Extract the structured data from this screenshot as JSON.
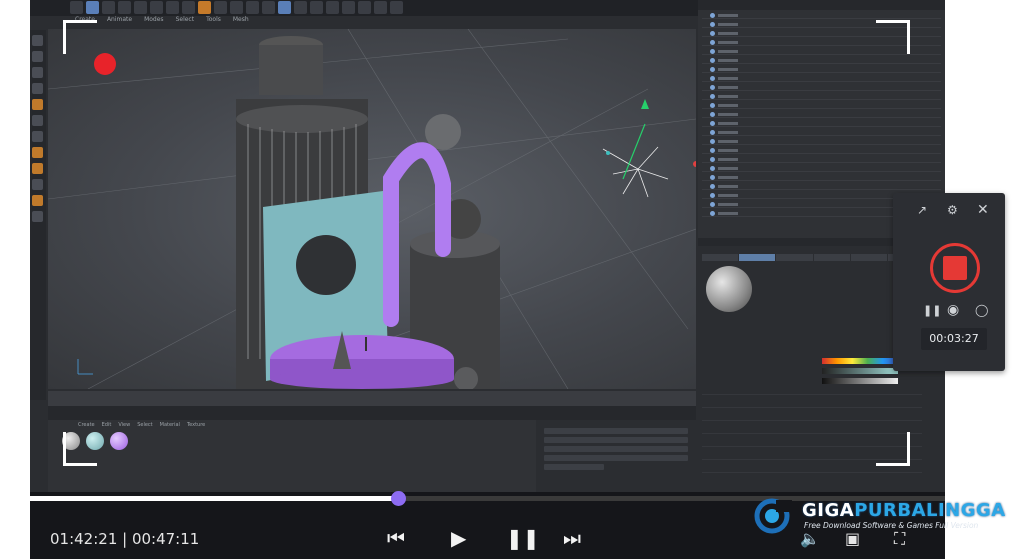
{
  "app": {
    "menu": [
      "Create",
      "Animate",
      "Modes",
      "Select",
      "Tools",
      "Mesh",
      "Snap",
      "Animate"
    ],
    "materials_menu": [
      "Create",
      "Edit",
      "View",
      "Select",
      "Material",
      "Texture"
    ]
  },
  "recorder": {
    "elapsed": "00:03:27",
    "icons": {
      "popout": "popout-icon",
      "settings": "settings-icon",
      "close": "close-icon",
      "pause": "pause-icon",
      "screenshot": "screenshot-icon",
      "marker": "marker-icon",
      "stop": "stop-record-icon",
      "expand": "chevron-right-icon"
    },
    "record_indicator_color": "#e8232a"
  },
  "player": {
    "time_readout": "01:42:21 | 00:47:11",
    "progress": 0.402,
    "accent": "#8d6cf2",
    "icons": [
      "skip-previous-icon",
      "play-icon",
      "pause-icon",
      "skip-next-icon",
      "volume-icon",
      "screenshot-icon",
      "fullscreen-icon"
    ]
  },
  "watermark": {
    "brand_part1": "GIGA",
    "brand_part2": "PURBALINGGA",
    "tagline": "Free Download Software & Games Full Version"
  }
}
